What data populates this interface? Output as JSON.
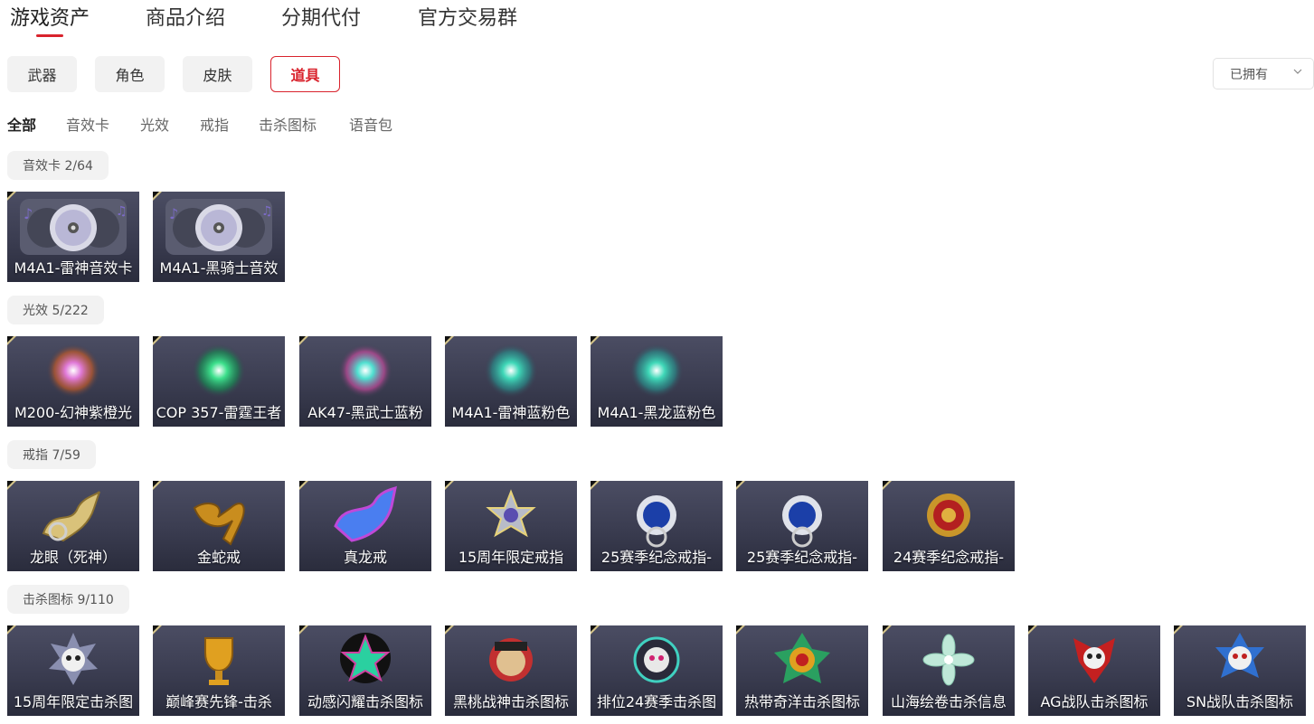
{
  "main_tabs": [
    {
      "label": "游戏资产"
    },
    {
      "label": "商品介绍"
    },
    {
      "label": "分期代付"
    },
    {
      "label": "官方交易群"
    }
  ],
  "categories": [
    {
      "label": "武器"
    },
    {
      "label": "角色"
    },
    {
      "label": "皮肤"
    },
    {
      "label": "道具"
    }
  ],
  "filter": {
    "selected": "已拥有"
  },
  "sub_tabs": [
    {
      "label": "全部"
    },
    {
      "label": "音效卡"
    },
    {
      "label": "光效"
    },
    {
      "label": "戒指"
    },
    {
      "label": "击杀图标"
    },
    {
      "label": "语音包"
    }
  ],
  "sections": [
    {
      "label": "音效卡 2/64",
      "items": [
        "M4A1-雷神音效卡",
        "M4A1-黑骑士音效"
      ]
    },
    {
      "label": "光效 5/222",
      "items": [
        "M200-幻神紫橙光",
        "COP 357-雷霆王者",
        "AK47-黑武士蓝粉",
        "M4A1-雷神蓝粉色",
        "M4A1-黑龙蓝粉色"
      ]
    },
    {
      "label": "戒指 7/59",
      "items": [
        "龙眼（死神）",
        "金蛇戒",
        "真龙戒",
        "15周年限定戒指",
        "25赛季纪念戒指-",
        "25赛季纪念戒指-",
        "24赛季纪念戒指-"
      ]
    },
    {
      "label": "击杀图标 9/110",
      "items": [
        "15周年限定击杀图",
        "巅峰赛先锋-击杀",
        "动感闪耀击杀图标",
        "黑桃战神击杀图标",
        "排位24赛季击杀图",
        "热带奇洋击杀图标",
        "山海绘卷击杀信息",
        "AG战队击杀图标",
        "SN战队击杀图标"
      ]
    }
  ],
  "colors": {
    "accent": "#d9232d",
    "card_bg": "#3f4156",
    "chip_bg": "#f2f2f2"
  }
}
